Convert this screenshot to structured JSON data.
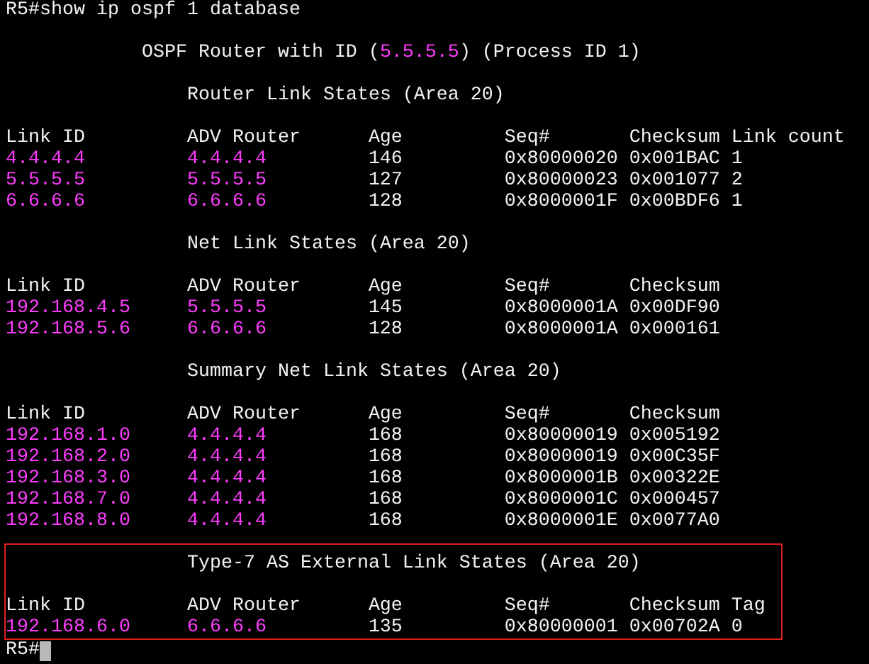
{
  "command": "R5#show ip ospf 1 database",
  "router_title": {
    "prefix": "OSPF Router with ID (",
    "router_id": "5.5.5.5",
    "suffix": ") (Process ID 1)"
  },
  "sections": [
    {
      "title": "Router Link States (Area 20)",
      "highlighted": false,
      "columns": [
        "Link ID",
        "ADV Router",
        "Age",
        "Seq#",
        "Checksum",
        "Link count"
      ],
      "rows": [
        [
          "4.4.4.4",
          "4.4.4.4",
          "146",
          "0x80000020",
          "0x001BAC",
          "1"
        ],
        [
          "5.5.5.5",
          "5.5.5.5",
          "127",
          "0x80000023",
          "0x001077",
          "2"
        ],
        [
          "6.6.6.6",
          "6.6.6.6",
          "128",
          "0x8000001F",
          "0x00BDF6",
          "1"
        ]
      ]
    },
    {
      "title": "Net Link States (Area 20)",
      "highlighted": false,
      "columns": [
        "Link ID",
        "ADV Router",
        "Age",
        "Seq#",
        "Checksum"
      ],
      "rows": [
        [
          "192.168.4.5",
          "5.5.5.5",
          "145",
          "0x8000001A",
          "0x00DF90"
        ],
        [
          "192.168.5.6",
          "6.6.6.6",
          "128",
          "0x8000001A",
          "0x000161"
        ]
      ]
    },
    {
      "title": "Summary Net Link States (Area 20)",
      "highlighted": false,
      "columns": [
        "Link ID",
        "ADV Router",
        "Age",
        "Seq#",
        "Checksum"
      ],
      "rows": [
        [
          "192.168.1.0",
          "4.4.4.4",
          "168",
          "0x80000019",
          "0x005192"
        ],
        [
          "192.168.2.0",
          "4.4.4.4",
          "168",
          "0x80000019",
          "0x00C35F"
        ],
        [
          "192.168.3.0",
          "4.4.4.4",
          "168",
          "0x8000001B",
          "0x00322E"
        ],
        [
          "192.168.7.0",
          "4.4.4.4",
          "168",
          "0x8000001C",
          "0x000457"
        ],
        [
          "192.168.8.0",
          "4.4.4.4",
          "168",
          "0x8000001E",
          "0x0077A0"
        ]
      ]
    },
    {
      "title": "Type-7 AS External Link States (Area 20)",
      "highlighted": true,
      "columns": [
        "Link ID",
        "ADV Router",
        "Age",
        "Seq#",
        "Checksum",
        "Tag"
      ],
      "rows": [
        [
          "192.168.6.0",
          "6.6.6.6",
          "135",
          "0x80000001",
          "0x00702A",
          "0"
        ]
      ]
    }
  ],
  "prompt": "R5#"
}
